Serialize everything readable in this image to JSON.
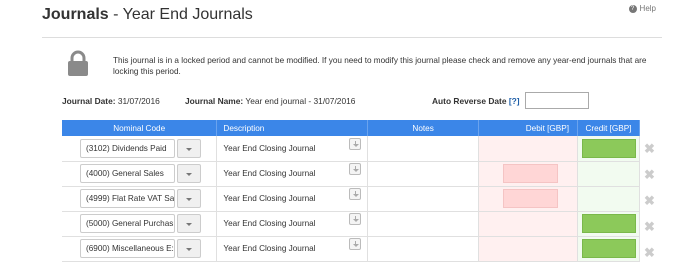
{
  "header": {
    "title_bold": "Journals",
    "title_rest": "- Year End Journals",
    "help_label": "Help"
  },
  "lock_notice": {
    "message": "This journal is in a locked period and cannot be modified. If you need to modify this journal please check and remove any year-end journals that are locking this period."
  },
  "journal": {
    "date_label": "Journal Date:",
    "date_value": "31/07/2016",
    "name_label": "Journal Name:",
    "name_value": "Year end journal - 31/07/2016",
    "auto_reverse_label": "Auto Reverse Date",
    "auto_reverse_help": "[?]",
    "auto_reverse_value": ""
  },
  "table": {
    "columns": [
      "Nominal Code",
      "Description",
      "Notes",
      "Debit [GBP]",
      "Credit [GBP]"
    ],
    "rows": [
      {
        "code": "(3102) Dividends Paid",
        "description": "Year End Closing Journal",
        "debit": "",
        "credit": "",
        "debit_filled": false,
        "credit_filled": true
      },
      {
        "code": "(4000) General Sales",
        "description": "Year End Closing Journal",
        "debit": "",
        "credit": "",
        "debit_filled": true,
        "credit_filled": false
      },
      {
        "code": "(4999) Flat Rate VAT Sa",
        "description": "Year End Closing Journal",
        "debit": "",
        "credit": "",
        "debit_filled": true,
        "credit_filled": false
      },
      {
        "code": "(5000) General Purchas",
        "description": "Year End Closing Journal",
        "debit": "",
        "credit": "",
        "debit_filled": false,
        "credit_filled": true
      },
      {
        "code": "(6900) Miscellaneous E:",
        "description": "Year End Closing Journal",
        "debit": "",
        "credit": "",
        "debit_filled": false,
        "credit_filled": true
      }
    ]
  },
  "colors": {
    "header_blue": "#3b86e8",
    "debit_fill": "#ffd6d6",
    "credit_fill": "#8cc95a"
  }
}
